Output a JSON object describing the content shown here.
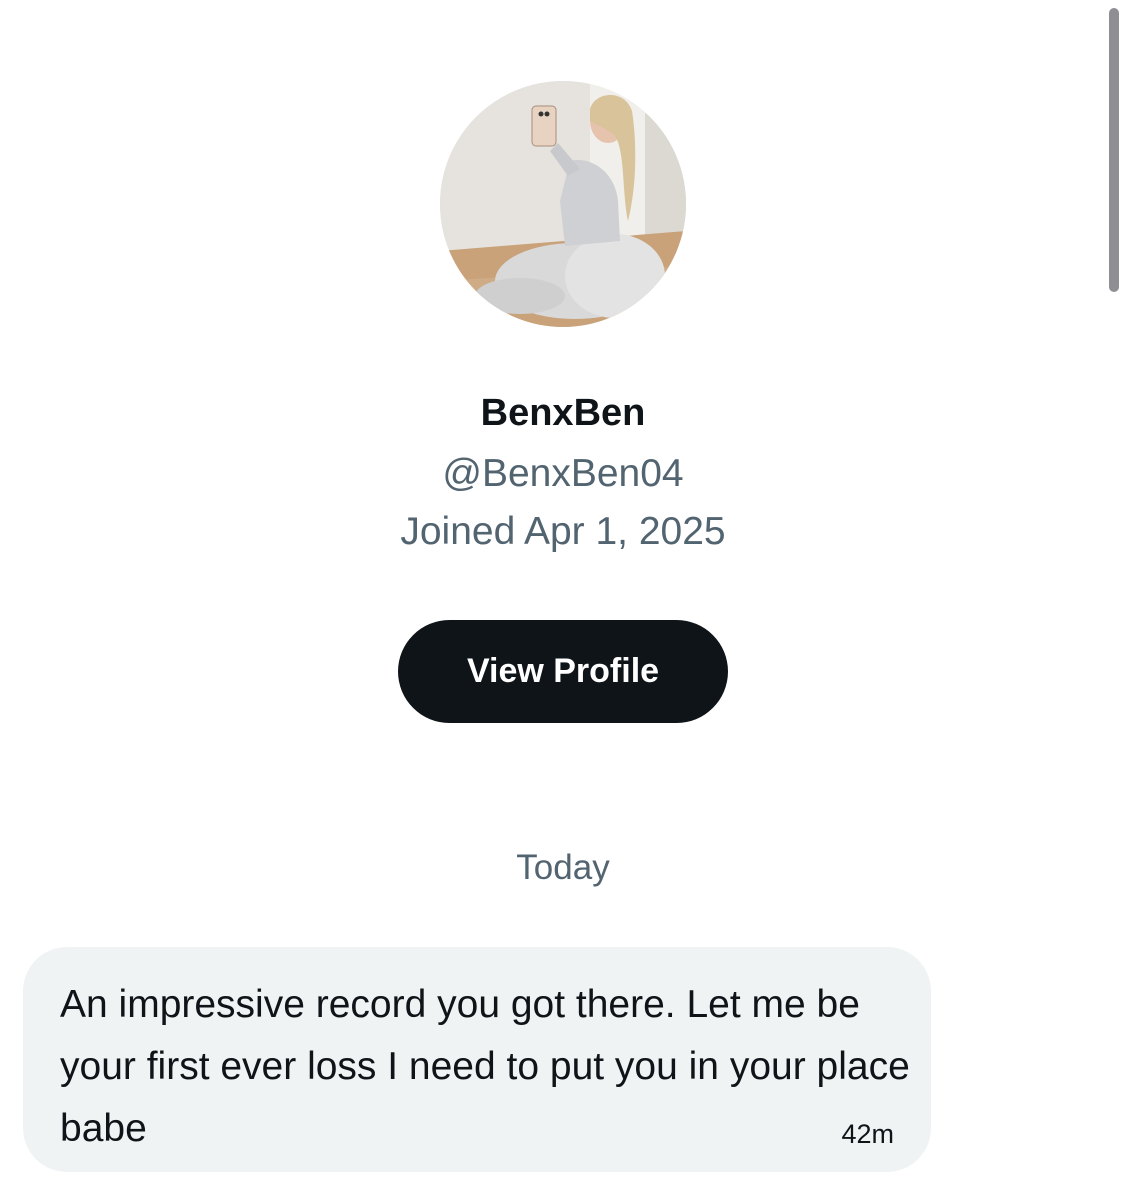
{
  "profile": {
    "avatar_alt": "profile photo",
    "display_name": "BenxBen",
    "handle": "@BenxBen04",
    "joined": "Joined Apr 1, 2025",
    "view_profile_label": "View Profile"
  },
  "conversation": {
    "date_divider": "Today",
    "messages": [
      {
        "text": "An impressive record you got there. Let me be your first ever loss I need to put you in your place babe",
        "time": "42m"
      }
    ]
  },
  "colors": {
    "primary_text": "#0f1419",
    "secondary_text": "#536471",
    "button_bg": "#0f1419",
    "bubble_bg": "#eff3f4"
  }
}
